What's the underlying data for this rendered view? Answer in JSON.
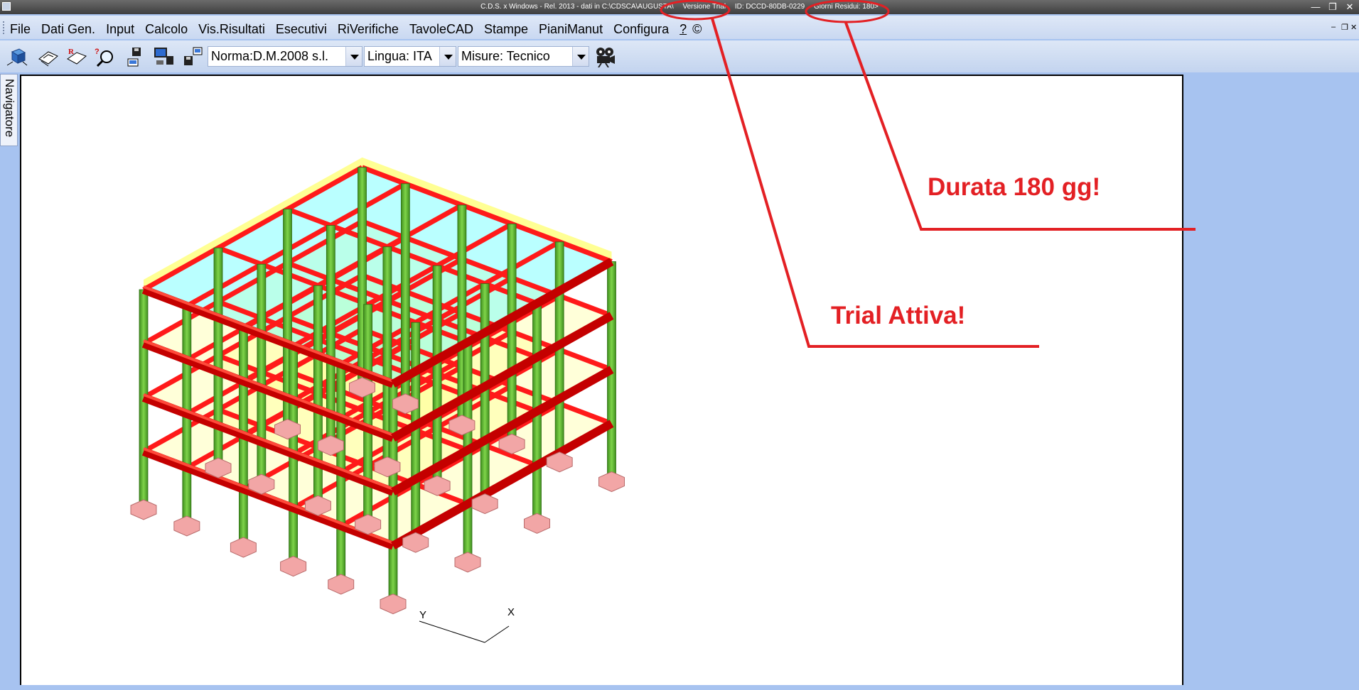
{
  "titlebar": {
    "app_title": "C.D.S. x Windows - Rel. 2013 - dati in C:\\CDSCA\\AUGUSTA\\",
    "trial_label": "Versione Trial",
    "id_label": "ID: DCCD-80DB-0229",
    "days_label": "Giorni Residui: 180>"
  },
  "menu": {
    "items": [
      "File",
      "Dati Gen.",
      "Input",
      "Calcolo",
      "Vis.Risultati",
      "Esecutivi",
      "RiVerifiche",
      "TavoleCAD",
      "Stampe",
      "PianiManut",
      "Configura"
    ],
    "help": "?",
    "about": "©"
  },
  "toolbar": {
    "norma": "Norma:D.M.2008 s.l.",
    "lingua": "Lingua: ITA",
    "misure": "Misure: Tecnico",
    "icons": [
      "3d-view-icon",
      "floor-plan-icon",
      "report-icon",
      "search-zoom-icon",
      "disk-save-icon",
      "computer-icon",
      "disk-export-icon",
      "camera-icon"
    ]
  },
  "sidebar": {
    "navigator_label": "Navigatore"
  },
  "viewport": {
    "axis_x": "X",
    "axis_y": "Y"
  },
  "annotations": {
    "duration": "Durata 180 gg!",
    "trial_active": "Trial Attiva!",
    "color": "#e32024"
  },
  "colors": {
    "beam": "#ff1a1a",
    "column": "#5cb82e",
    "slab_yellow": "#ffff66",
    "slab_cyan": "#66ffff",
    "footing": "#f2a6a6"
  }
}
